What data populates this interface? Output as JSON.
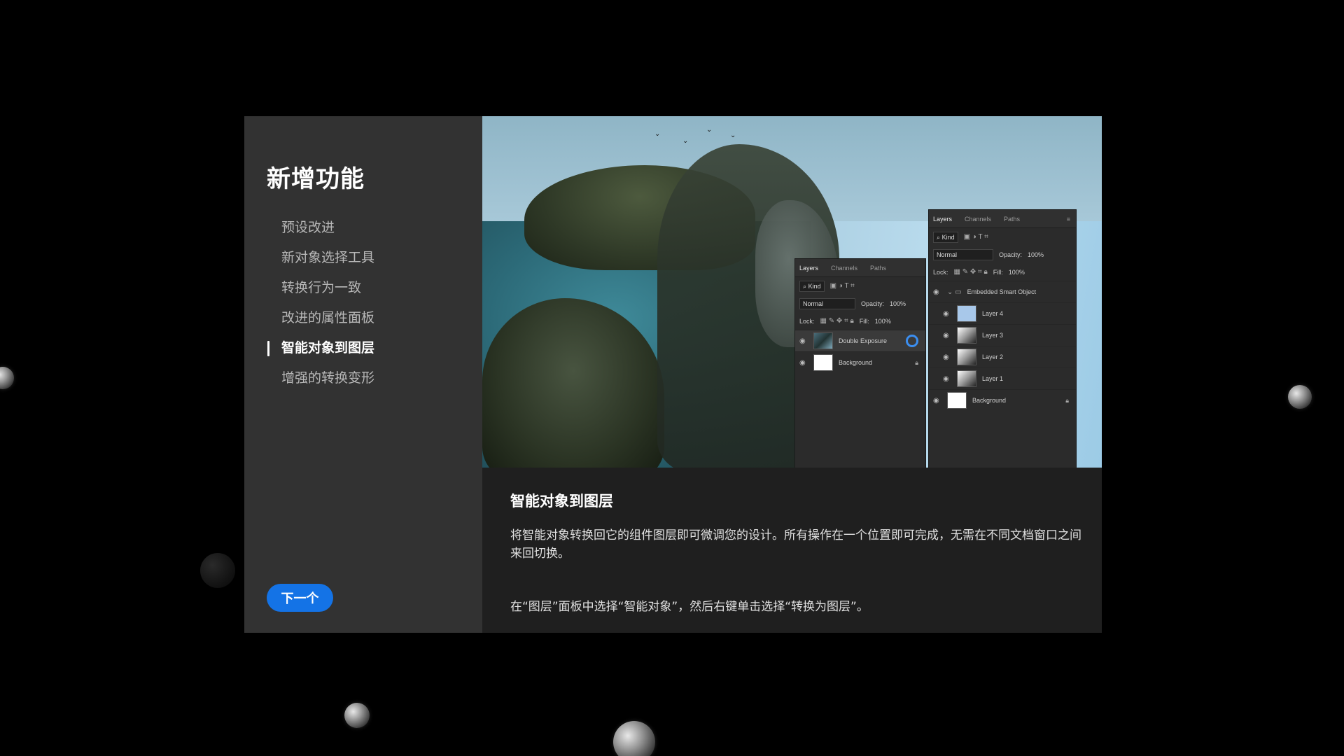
{
  "dialog": {
    "sidebar": {
      "title": "新增功能",
      "items": [
        {
          "label": "预设改进"
        },
        {
          "label": "新对象选择工具"
        },
        {
          "label": "转换行为一致"
        },
        {
          "label": "改进的属性面板"
        },
        {
          "label": "智能对象到图层"
        },
        {
          "label": "增强的转换变形"
        }
      ],
      "active_index": 4,
      "next_label": "下一个"
    },
    "main": {
      "title": "智能对象到图层",
      "body": "将智能对象转换回它的组件图层即可微调您的设计。所有操作在一个位置即可完成，无需在不同文档窗口之间来回切换。",
      "instruction": "在“图层”面板中选择“智能对象”，然后右键单击选择“转换为图层”。"
    },
    "panel_left": {
      "tabs": [
        "Layers",
        "Channels",
        "Paths"
      ],
      "filter": "Kind",
      "blend": "Normal",
      "opacity_label": "Opacity:",
      "opacity": "100%",
      "lock_label": "Lock:",
      "fill_label": "Fill:",
      "fill": "100%",
      "layers": [
        {
          "name": "Double Exposure"
        },
        {
          "name": "Background"
        }
      ]
    },
    "panel_right": {
      "tabs": [
        "Layers",
        "Channels",
        "Paths"
      ],
      "filter": "Kind",
      "blend": "Normal",
      "opacity_label": "Opacity:",
      "opacity": "100%",
      "lock_label": "Lock:",
      "fill_label": "Fill:",
      "fill": "100%",
      "group": "Embedded Smart Object",
      "layers": [
        {
          "name": "Layer 4"
        },
        {
          "name": "Layer 3"
        },
        {
          "name": "Layer 2"
        },
        {
          "name": "Layer 1"
        },
        {
          "name": "Background"
        }
      ]
    }
  },
  "colors": {
    "accent": "#1473e6",
    "sidebar_bg": "#323232",
    "main_bg": "#1f1f1f"
  },
  "icons": [
    "eye-icon",
    "lock-icon",
    "search-icon",
    "folder-icon",
    "panel-menu-icon"
  ]
}
